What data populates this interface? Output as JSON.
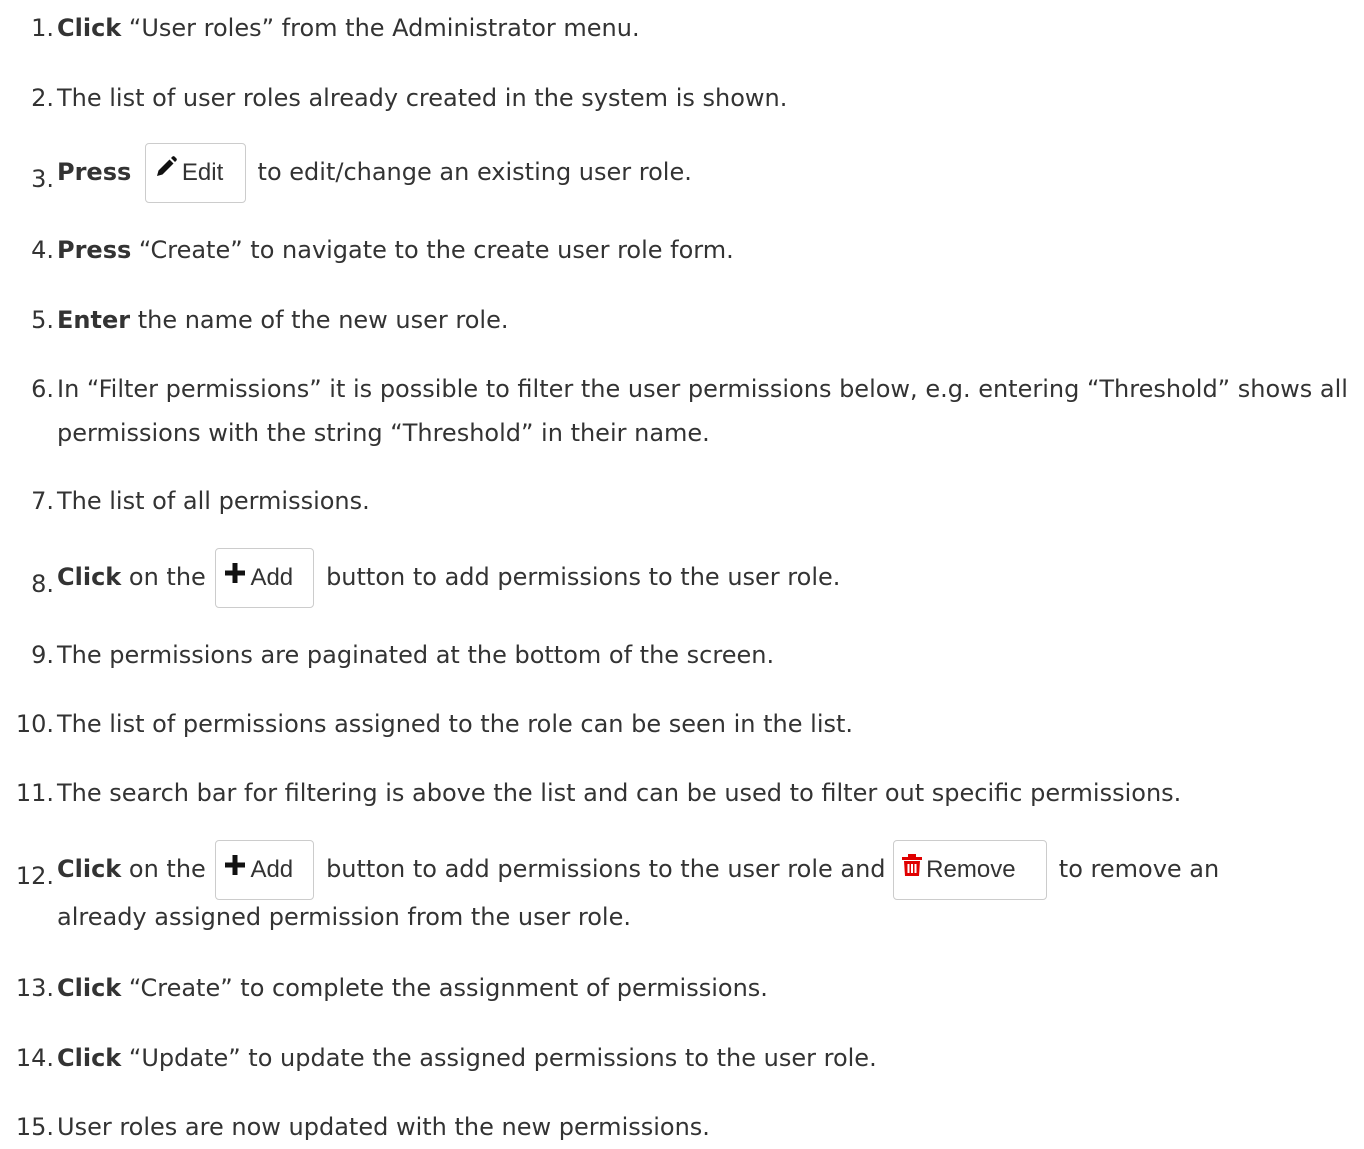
{
  "steps": [
    {
      "num": "1.",
      "bold": "Click",
      "text": " “User roles” from the Administrator menu."
    },
    {
      "num": "2.",
      "text": "The list of user roles already created in the system is shown."
    },
    {
      "num": "3.",
      "bold": "Press",
      "button": {
        "label": "Edit",
        "icon": "pencil-icon"
      },
      "after": " to edit/change an existing user role."
    },
    {
      "num": "4.",
      "bold": "Press",
      "text": " “Create” to navigate to the create user role form."
    },
    {
      "num": "5.",
      "bold": "Enter",
      "text": " the name of the new user role."
    },
    {
      "num": "6.",
      "text": "In “Filter permissions” it is possible to filter the user permissions below, e.g. entering “Threshold” shows all permissions with the string “Threshold” in their name."
    },
    {
      "num": "7.",
      "text": "The list of all permissions."
    },
    {
      "num": "8.",
      "bold": "Click",
      "before": " on the ",
      "button": {
        "label": "Add",
        "icon": "plus-icon"
      },
      "after": " button to add permissions to the user role."
    },
    {
      "num": "9.",
      "text": "The permissions are paginated at the bottom of the screen."
    },
    {
      "num": "10.",
      "text": "The list of permissions assigned to the role can be seen in the list."
    },
    {
      "num": "11.",
      "text": "The search bar for filtering is above the list and can be used to filter out specific permissions."
    },
    {
      "num": "12.",
      "bold": "Click",
      "before": " on the ",
      "button": {
        "label": "Add",
        "icon": "plus-icon"
      },
      "middle": " button to add permissions to the user role and ",
      "button2": {
        "label": "Remove",
        "icon": "trash-icon"
      },
      "after": " to remove an",
      "line2": "already assigned permission from the user role."
    },
    {
      "num": "13.",
      "bold": "Click",
      "text": " “Create” to complete the assignment of permissions."
    },
    {
      "num": "14.",
      "bold": "Click",
      "text": " “Update” to update the assigned permissions to the user role."
    },
    {
      "num": "15.",
      "text": "User roles are now updated with the new permissions."
    }
  ],
  "colors": {
    "text": "#333333",
    "remove_icon": "#e00000",
    "button_border": "#cccccc"
  }
}
